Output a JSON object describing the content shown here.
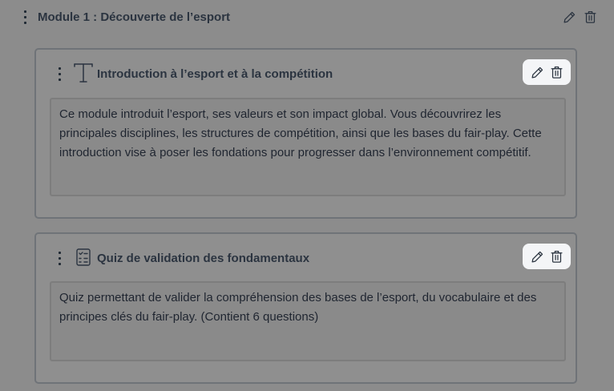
{
  "module": {
    "title": "Module 1 : Découverte de l’esport",
    "icons": {
      "drag": "drag-handle-icon",
      "edit": "pencil-icon",
      "delete": "trash-icon"
    }
  },
  "items": [
    {
      "type_icon": "text-icon",
      "title": "Introduction à l’esport et à la compétition",
      "description": "Ce module introduit l’esport, ses valeurs et son impact global. Vous découvrirez les principales disciplines, les structures de compétition, ainsi que les bases du fair-play. Cette introduction vise à poser les fondations pour progresser dans l’environnement compétitif."
    },
    {
      "type_icon": "quiz-icon",
      "title": "Quiz de validation des fondamentaux",
      "description": "Quiz permettant de valider la compréhension des bases de l’esport, du vocabulaire et des principes clés du fair-play. (Contient 6 questions)"
    }
  ],
  "colors": {
    "backdrop": "#8c8c8c",
    "action_pill": "#f4f5f7",
    "text": "#2b3440"
  }
}
